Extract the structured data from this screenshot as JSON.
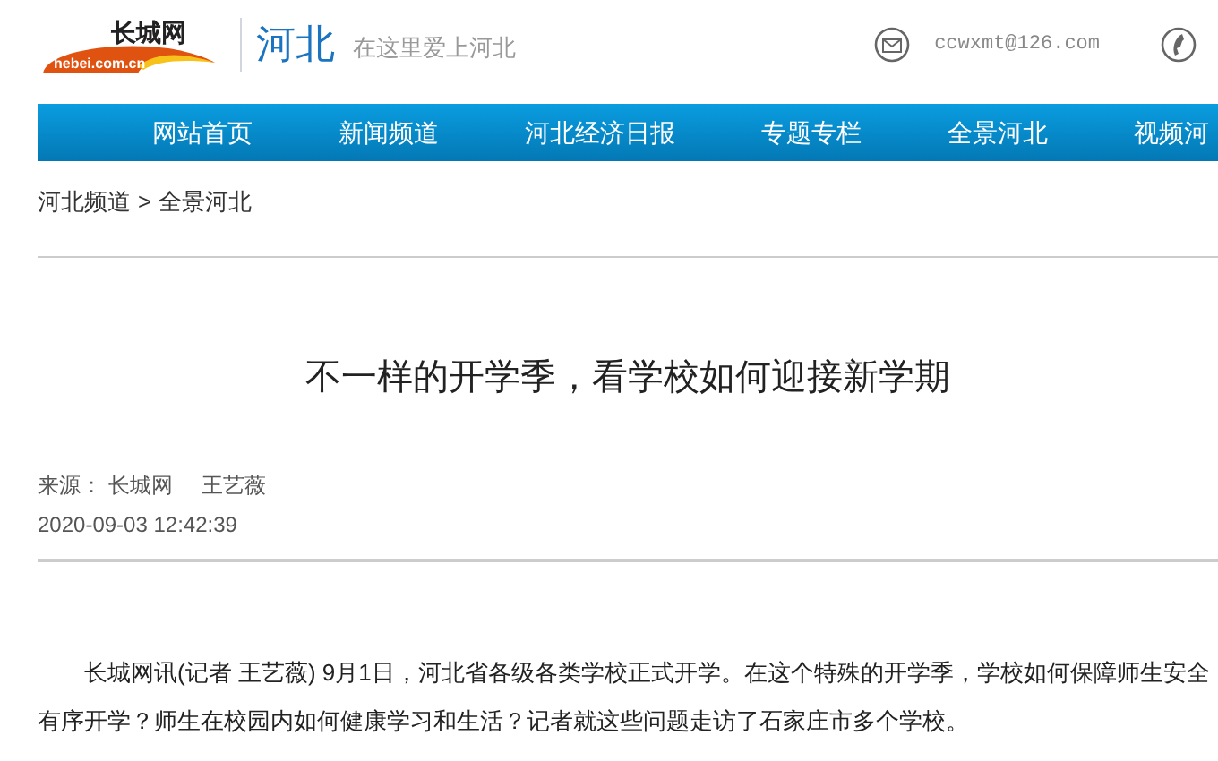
{
  "header": {
    "logo_text": "长城网",
    "logo_domain": "hebei.com.cn",
    "channel": "河北",
    "slogan": "在这里爱上河北",
    "email": "ccwxmt@126.com"
  },
  "nav": [
    {
      "label": "网站首页"
    },
    {
      "label": "新闻频道"
    },
    {
      "label": "河北经济日报"
    },
    {
      "label": "专题专栏"
    },
    {
      "label": "全景河北"
    },
    {
      "label": "视频河"
    }
  ],
  "breadcrumb": {
    "items": [
      "河北频道",
      "全景河北"
    ],
    "separator": ">"
  },
  "article": {
    "title": "不一样的开学季，看学校如何迎接新学期",
    "source_label": "来源：",
    "source": "长城网",
    "author": "王艺薇",
    "date": "2020-09-03 12:42:39",
    "paragraphs": [
      "长城网讯(记者 王艺薇) 9月1日，河北省各级各类学校正式开学。在这个特殊的开学季，学校如何保障师生安全有序开学？师生在校园内如何健康学习和生活？记者就这些问题走访了石家庄市多个学校。"
    ]
  }
}
